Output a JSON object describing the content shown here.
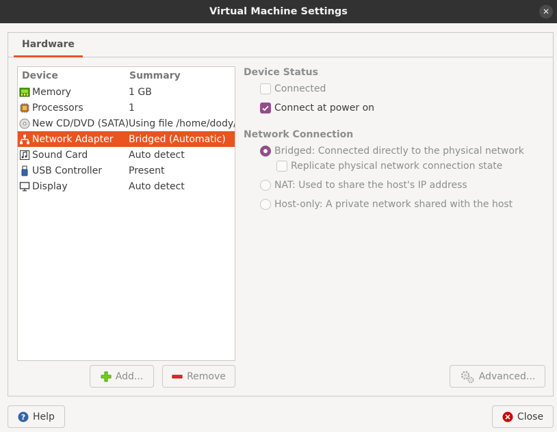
{
  "window": {
    "title": "Virtual Machine Settings",
    "close_glyph": "✕"
  },
  "tabs": [
    {
      "label": "Hardware"
    }
  ],
  "device_list": {
    "columns": {
      "device": "Device",
      "summary": "Summary"
    },
    "rows": [
      {
        "icon": "memory-icon",
        "device": "Memory",
        "summary": "1 GB"
      },
      {
        "icon": "processor-icon",
        "device": "Processors",
        "summary": "1"
      },
      {
        "icon": "cd-dvd-icon",
        "device": "New CD/DVD (SATA)",
        "summary": "Using file /home/dody/l"
      },
      {
        "icon": "network-icon",
        "device": "Network Adapter",
        "summary": "Bridged (Automatic)",
        "selected": true
      },
      {
        "icon": "sound-icon",
        "device": "Sound Card",
        "summary": "Auto detect"
      },
      {
        "icon": "usb-icon",
        "device": "USB Controller",
        "summary": "Present"
      },
      {
        "icon": "display-icon",
        "device": "Display",
        "summary": "Auto detect"
      }
    ]
  },
  "buttons": {
    "add": "Add...",
    "remove": "Remove",
    "advanced": "Advanced...",
    "help": "Help",
    "close": "Close"
  },
  "device_status": {
    "title": "Device Status",
    "connected": {
      "label": "Connected",
      "checked": false
    },
    "connect_at_power_on": {
      "label": "Connect at power on",
      "checked": true
    }
  },
  "network_connection": {
    "title": "Network Connection",
    "bridged": {
      "label": "Bridged: Connected directly to the physical network",
      "selected": true
    },
    "replicate": {
      "label": "Replicate physical network connection state",
      "checked": false
    },
    "nat": {
      "label": "NAT: Used to share the host's IP address",
      "selected": false
    },
    "host_only": {
      "label": "Host-only: A private network shared with the host",
      "selected": false
    }
  },
  "colors": {
    "accent": "#e95420",
    "check": "#924d8b",
    "titlebar": "#333232"
  }
}
